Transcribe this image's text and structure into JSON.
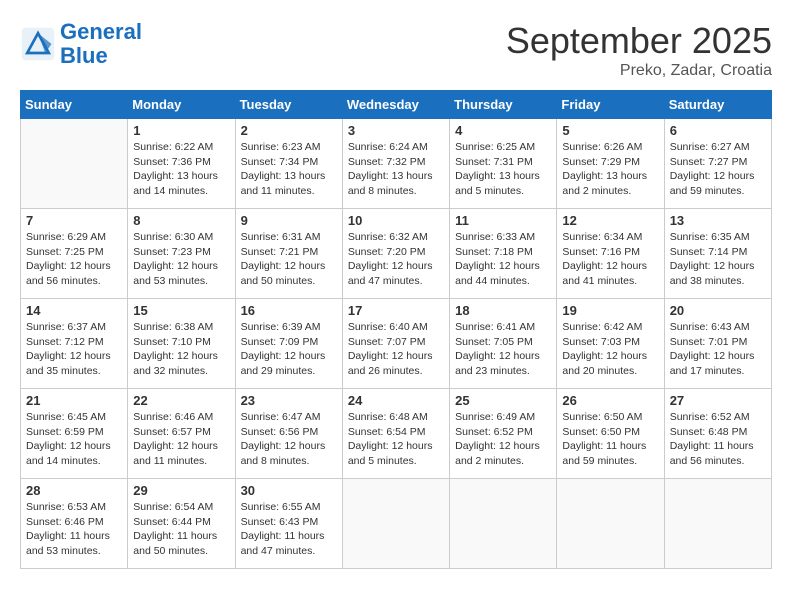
{
  "header": {
    "logo_line1": "General",
    "logo_line2": "Blue",
    "month": "September 2025",
    "location": "Preko, Zadar, Croatia"
  },
  "calendar": {
    "days_of_week": [
      "Sunday",
      "Monday",
      "Tuesday",
      "Wednesday",
      "Thursday",
      "Friday",
      "Saturday"
    ],
    "weeks": [
      [
        {
          "day": "",
          "info": ""
        },
        {
          "day": "1",
          "info": "Sunrise: 6:22 AM\nSunset: 7:36 PM\nDaylight: 13 hours\nand 14 minutes."
        },
        {
          "day": "2",
          "info": "Sunrise: 6:23 AM\nSunset: 7:34 PM\nDaylight: 13 hours\nand 11 minutes."
        },
        {
          "day": "3",
          "info": "Sunrise: 6:24 AM\nSunset: 7:32 PM\nDaylight: 13 hours\nand 8 minutes."
        },
        {
          "day": "4",
          "info": "Sunrise: 6:25 AM\nSunset: 7:31 PM\nDaylight: 13 hours\nand 5 minutes."
        },
        {
          "day": "5",
          "info": "Sunrise: 6:26 AM\nSunset: 7:29 PM\nDaylight: 13 hours\nand 2 minutes."
        },
        {
          "day": "6",
          "info": "Sunrise: 6:27 AM\nSunset: 7:27 PM\nDaylight: 12 hours\nand 59 minutes."
        }
      ],
      [
        {
          "day": "7",
          "info": "Sunrise: 6:29 AM\nSunset: 7:25 PM\nDaylight: 12 hours\nand 56 minutes."
        },
        {
          "day": "8",
          "info": "Sunrise: 6:30 AM\nSunset: 7:23 PM\nDaylight: 12 hours\nand 53 minutes."
        },
        {
          "day": "9",
          "info": "Sunrise: 6:31 AM\nSunset: 7:21 PM\nDaylight: 12 hours\nand 50 minutes."
        },
        {
          "day": "10",
          "info": "Sunrise: 6:32 AM\nSunset: 7:20 PM\nDaylight: 12 hours\nand 47 minutes."
        },
        {
          "day": "11",
          "info": "Sunrise: 6:33 AM\nSunset: 7:18 PM\nDaylight: 12 hours\nand 44 minutes."
        },
        {
          "day": "12",
          "info": "Sunrise: 6:34 AM\nSunset: 7:16 PM\nDaylight: 12 hours\nand 41 minutes."
        },
        {
          "day": "13",
          "info": "Sunrise: 6:35 AM\nSunset: 7:14 PM\nDaylight: 12 hours\nand 38 minutes."
        }
      ],
      [
        {
          "day": "14",
          "info": "Sunrise: 6:37 AM\nSunset: 7:12 PM\nDaylight: 12 hours\nand 35 minutes."
        },
        {
          "day": "15",
          "info": "Sunrise: 6:38 AM\nSunset: 7:10 PM\nDaylight: 12 hours\nand 32 minutes."
        },
        {
          "day": "16",
          "info": "Sunrise: 6:39 AM\nSunset: 7:09 PM\nDaylight: 12 hours\nand 29 minutes."
        },
        {
          "day": "17",
          "info": "Sunrise: 6:40 AM\nSunset: 7:07 PM\nDaylight: 12 hours\nand 26 minutes."
        },
        {
          "day": "18",
          "info": "Sunrise: 6:41 AM\nSunset: 7:05 PM\nDaylight: 12 hours\nand 23 minutes."
        },
        {
          "day": "19",
          "info": "Sunrise: 6:42 AM\nSunset: 7:03 PM\nDaylight: 12 hours\nand 20 minutes."
        },
        {
          "day": "20",
          "info": "Sunrise: 6:43 AM\nSunset: 7:01 PM\nDaylight: 12 hours\nand 17 minutes."
        }
      ],
      [
        {
          "day": "21",
          "info": "Sunrise: 6:45 AM\nSunset: 6:59 PM\nDaylight: 12 hours\nand 14 minutes."
        },
        {
          "day": "22",
          "info": "Sunrise: 6:46 AM\nSunset: 6:57 PM\nDaylight: 12 hours\nand 11 minutes."
        },
        {
          "day": "23",
          "info": "Sunrise: 6:47 AM\nSunset: 6:56 PM\nDaylight: 12 hours\nand 8 minutes."
        },
        {
          "day": "24",
          "info": "Sunrise: 6:48 AM\nSunset: 6:54 PM\nDaylight: 12 hours\nand 5 minutes."
        },
        {
          "day": "25",
          "info": "Sunrise: 6:49 AM\nSunset: 6:52 PM\nDaylight: 12 hours\nand 2 minutes."
        },
        {
          "day": "26",
          "info": "Sunrise: 6:50 AM\nSunset: 6:50 PM\nDaylight: 11 hours\nand 59 minutes."
        },
        {
          "day": "27",
          "info": "Sunrise: 6:52 AM\nSunset: 6:48 PM\nDaylight: 11 hours\nand 56 minutes."
        }
      ],
      [
        {
          "day": "28",
          "info": "Sunrise: 6:53 AM\nSunset: 6:46 PM\nDaylight: 11 hours\nand 53 minutes."
        },
        {
          "day": "29",
          "info": "Sunrise: 6:54 AM\nSunset: 6:44 PM\nDaylight: 11 hours\nand 50 minutes."
        },
        {
          "day": "30",
          "info": "Sunrise: 6:55 AM\nSunset: 6:43 PM\nDaylight: 11 hours\nand 47 minutes."
        },
        {
          "day": "",
          "info": ""
        },
        {
          "day": "",
          "info": ""
        },
        {
          "day": "",
          "info": ""
        },
        {
          "day": "",
          "info": ""
        }
      ]
    ]
  }
}
